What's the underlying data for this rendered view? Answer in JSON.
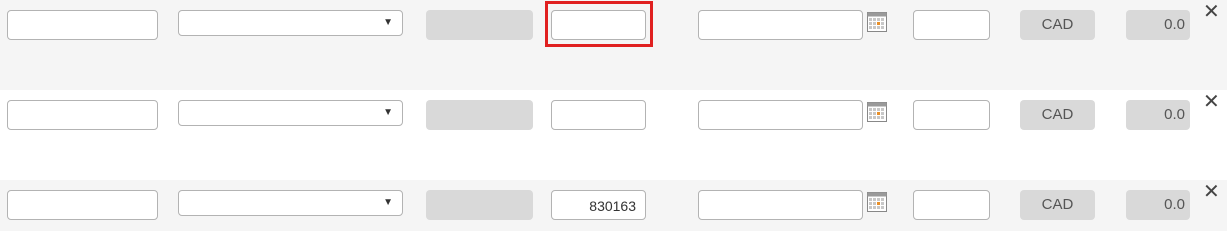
{
  "rows": [
    {
      "ref_value": "",
      "currency": "CAD",
      "amount": "0.0"
    },
    {
      "ref_value": "",
      "currency": "CAD",
      "amount": "0.0"
    },
    {
      "ref_value": "830163",
      "currency": "CAD",
      "amount": "0.0"
    }
  ],
  "icons": {
    "dropdown": "▼",
    "calendar": "calendar-icon",
    "remove": "✕"
  },
  "colors": {
    "highlight_border": "#e02020",
    "readonly_fill": "#d9d9d9",
    "row_shade": "#f5f5f5"
  }
}
